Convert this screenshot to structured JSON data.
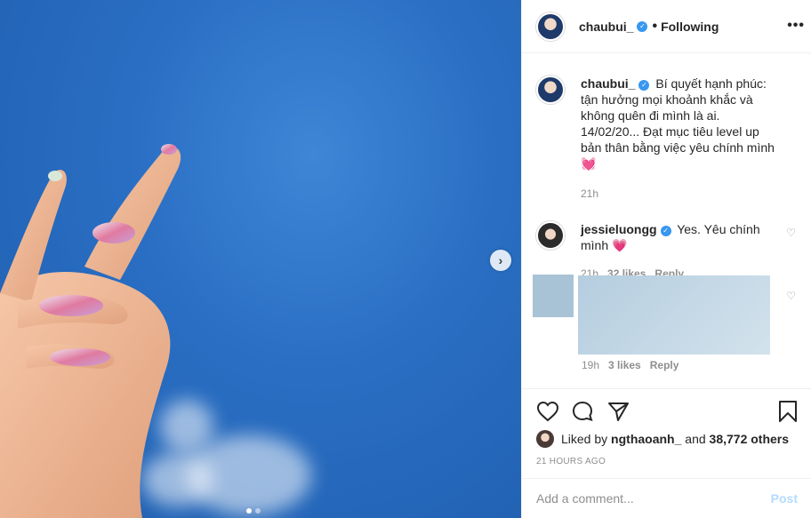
{
  "post": {
    "image_alt": "hand against blue sky",
    "carousel": {
      "total": 2,
      "active": 1,
      "next_icon": "chevron-right-icon",
      "next_glyph": "›"
    }
  },
  "header": {
    "username": "chaubui_",
    "verified_glyph": "✓",
    "separator": "•",
    "follow_status": "Following",
    "more_glyph": "•••"
  },
  "caption": {
    "username": "chaubui_",
    "text": "Bí quyết hạnh phúc: tận hưởng mọi khoảnh khắc và không quên đi mình là ai. 14/02/20... Đạt mục tiêu level up bản thân bằng việc yêu chính mình💓",
    "time": "21h"
  },
  "comments": [
    {
      "username": "jessieluongg",
      "text": "Yes. Yêu chính mình 💗",
      "time": "21h",
      "likes": "32 likes",
      "reply": "Reply",
      "heart_glyph": "♡"
    },
    {
      "username": "",
      "text": "",
      "time": "19h",
      "likes": "3 likes",
      "reply": "Reply",
      "heart_glyph": "♡"
    }
  ],
  "actions": {
    "icons": [
      "heart-icon",
      "comment-icon",
      "share-icon",
      "bookmark-icon"
    ],
    "liked_by_prefix": "Liked by",
    "liked_by_user": "ngthaoanh_",
    "liked_by_and": "and",
    "liked_by_count": "38,772 others",
    "timestamp": "21 HOURS AGO"
  },
  "add_comment": {
    "placeholder": "Add a comment...",
    "post_label": "Post"
  },
  "colors": {
    "accent": "#3897f0",
    "post_disabled": "#b3dbff",
    "muted": "#8e8e8e",
    "sky": "#2a6fc4"
  }
}
